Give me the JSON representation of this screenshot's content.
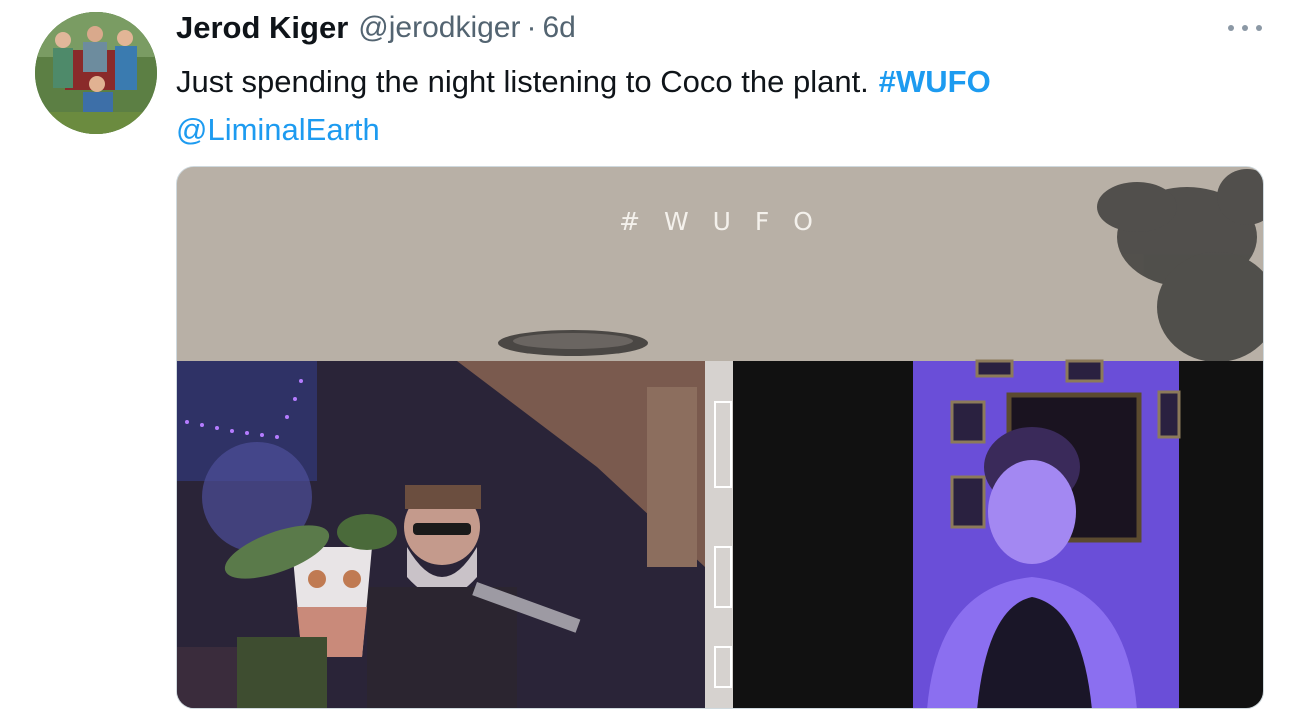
{
  "tweet": {
    "author": {
      "display_name": "Jerod Kiger",
      "handle": "@jerodkiger",
      "separator": "·",
      "time": "6d"
    },
    "text": {
      "body": "Just spending the night listening to Coco the plant.",
      "hashtag": "#WUFO",
      "mention": "@LiminalEarth"
    },
    "media": {
      "overlay_text": "# W U F O"
    },
    "icons": {
      "more": "more-options-icon"
    }
  }
}
